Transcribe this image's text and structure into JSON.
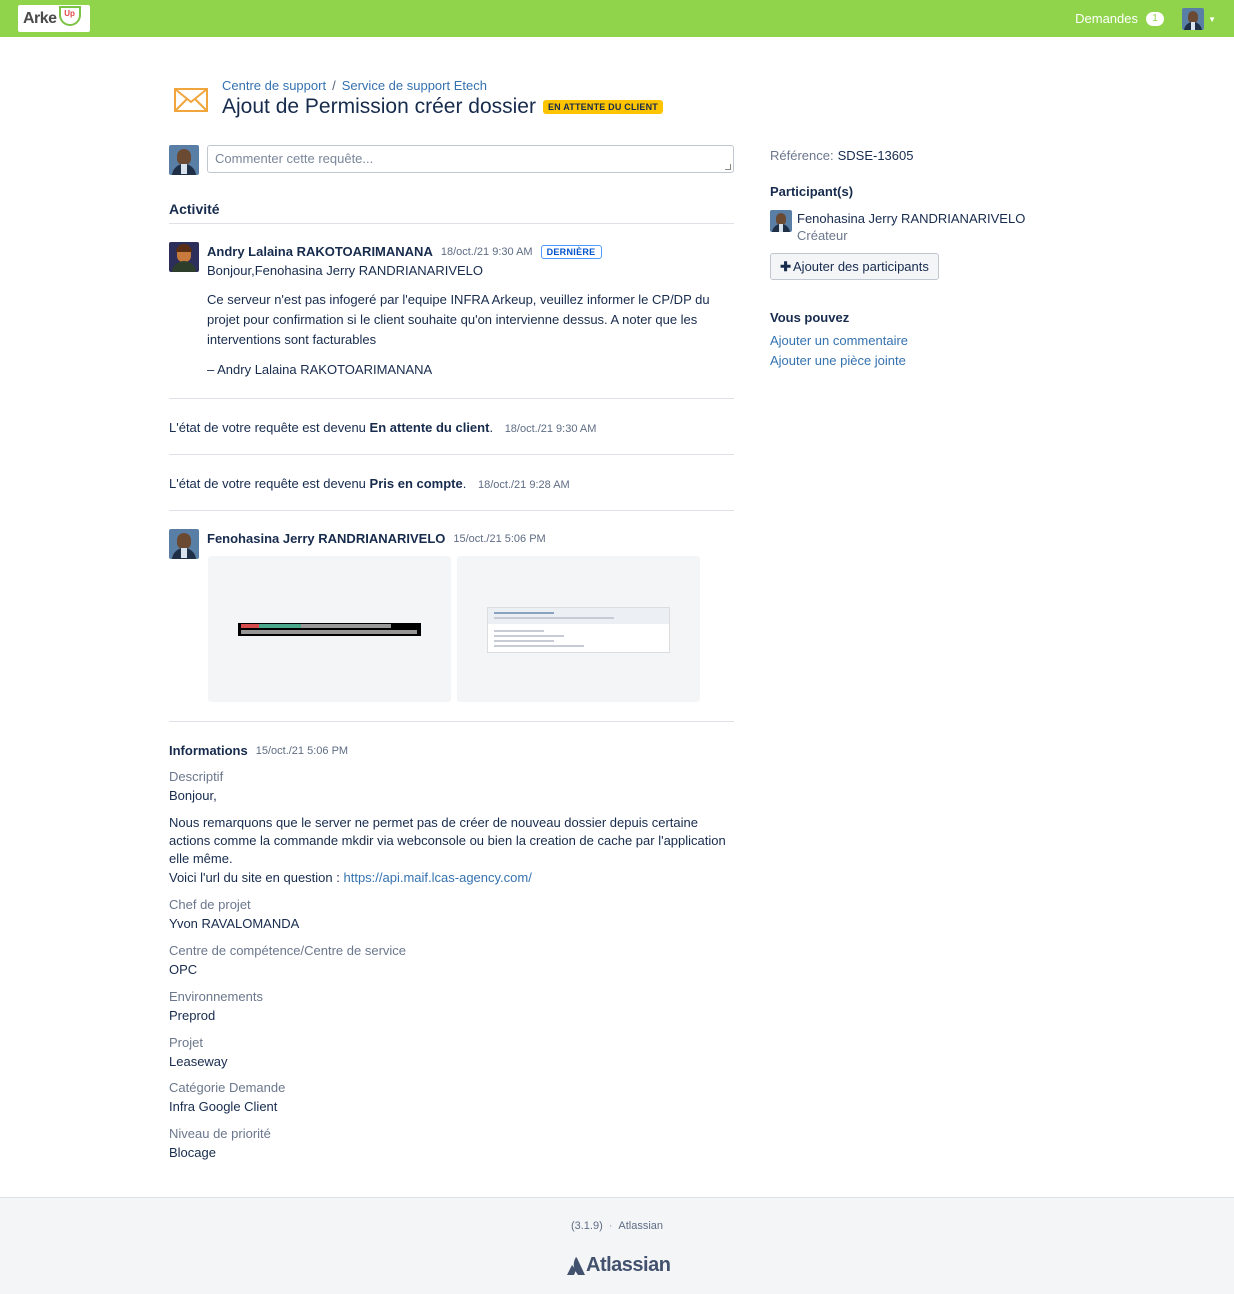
{
  "header": {
    "logo_text": "Arke",
    "logo_badge": "Up",
    "requests_label": "Demandes",
    "requests_count": "1"
  },
  "breadcrumb": {
    "items": [
      "Centre de support",
      "Service de support Etech"
    ],
    "separator": "/"
  },
  "request": {
    "title": "Ajout de Permission créer dossier",
    "status": "EN ATTENTE DU CLIENT"
  },
  "comment": {
    "placeholder": "Commenter cette requête..."
  },
  "activity": {
    "heading": "Activité",
    "comment1": {
      "author": "Andry Lalaina RAKOTOARIMANANA",
      "time": "18/oct./21 9:30 AM",
      "badge": "DERNIÈRE",
      "greeting": "Bonjour,Fenohasina Jerry RANDRIANARIVELO",
      "body": "Ce serveur n'est pas infogeré par l'equipe INFRA Arkeup, veuillez informer le CP/DP du projet pour confirmation si le client souhaite qu'on intervienne dessus. A noter que les interventions sont facturables",
      "signature": "– Andry Lalaina RAKOTOARIMANANA"
    },
    "state1": {
      "prefix": "L'état de votre requête est devenu",
      "state": "En attente du client",
      "suffix": ".",
      "time": "18/oct./21 9:30 AM"
    },
    "state2": {
      "prefix": "L'état de votre requête est devenu",
      "state": "Pris en compte",
      "suffix": ".",
      "time": "18/oct./21 9:28 AM"
    },
    "comment2": {
      "author": "Fenohasina Jerry RANDRIANARIVELO",
      "time": "15/oct./21 5:06 PM"
    }
  },
  "informations": {
    "heading": "Informations",
    "time": "15/oct./21 5:06 PM",
    "descriptif_label": "Descriptif",
    "desc_greeting": "Bonjour,",
    "desc_body": "Nous remarquons que le server ne permet pas de créer de nouveau dossier depuis certaine actions comme la commande mkdir via webconsole ou bien la creation de cache par l'application elle même.",
    "desc_url_prefix": "Voici l'url du site en question :",
    "desc_url": "https://api.maif.lcas-agency.com/",
    "fields": [
      {
        "label": "Chef de projet",
        "value": "Yvon RAVALOMANDA"
      },
      {
        "label": "Centre de compétence/Centre de service",
        "value": "OPC"
      },
      {
        "label": "Environnements",
        "value": "Preprod"
      },
      {
        "label": "Projet",
        "value": "Leaseway"
      },
      {
        "label": "Catégorie Demande",
        "value": "Infra Google Client"
      },
      {
        "label": "Niveau de priorité",
        "value": "Blocage"
      }
    ]
  },
  "sidebar": {
    "reference_label": "Référence:",
    "reference_value": "SDSE-13605",
    "participants_heading": "Participant(s)",
    "participant_name": "Fenohasina Jerry RANDRIANARIVELO",
    "participant_role": "Créateur",
    "add_participants": "Ajouter des participants",
    "actions_heading": "Vous pouvez",
    "actions": [
      "Ajouter un commentaire",
      "Ajouter une pièce jointe"
    ]
  },
  "footer": {
    "version": "(3.1.9)",
    "vendor": "Atlassian",
    "logo_text": "Atlassian"
  },
  "colors": {
    "header_bg": "#8fd44a",
    "status_lozenge": "#ffc400",
    "link": "#3572b0"
  }
}
